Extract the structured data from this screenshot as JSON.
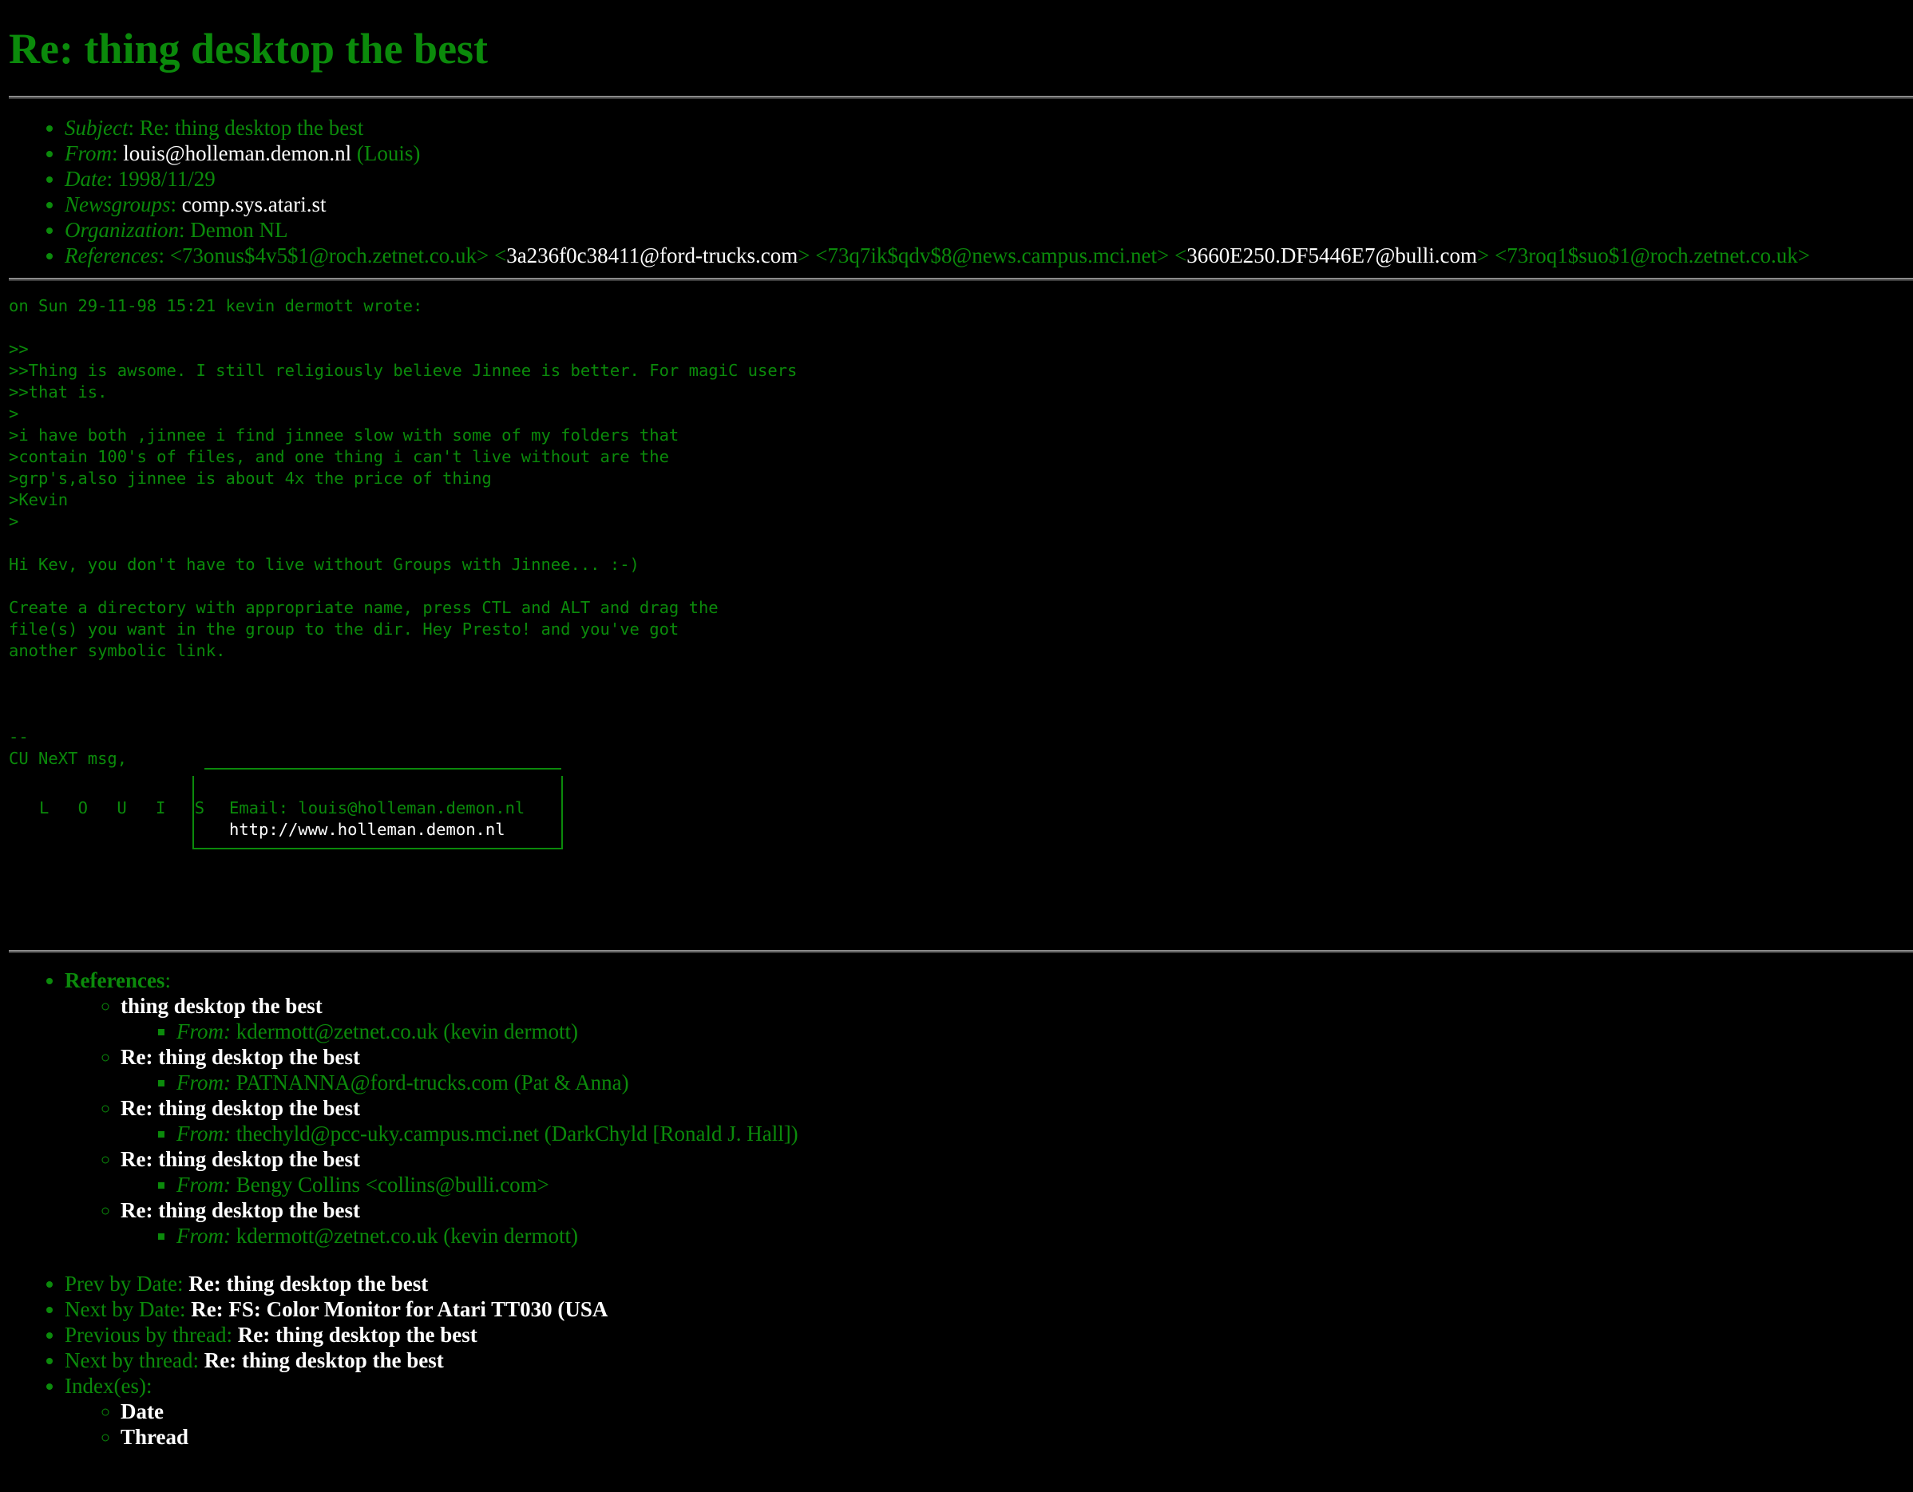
{
  "title": "Re: thing desktop the best",
  "meta": {
    "subject_label": "Subject",
    "subject": "Re: thing desktop the best",
    "from_label": "From",
    "from_email": "louis@holleman.demon.nl",
    "from_name": "(Louis)",
    "date_label": "Date",
    "date": "1998/11/29",
    "newsgroups_label": "Newsgroups",
    "newsgroups": "comp.sys.atari.st",
    "org_label": "Organization",
    "org": "Demon NL",
    "references_label": "References",
    "references": [
      "<73onus$4v5$1@roch.zetnet.co.uk>",
      "3a236f0c38411@ford-trucks.com",
      "<73q7ik$qdv$8@news.campus.mci.net>",
      "3660E250.DF5446E7@bulli.com",
      "<73roq1$suo$1@roch.zetnet.co.uk>"
    ]
  },
  "body_text": "on Sun 29-11-98 15:21 kevin dermott wrote:\n\n>>\n>>Thing is awsome. I still religiously believe Jinnee is better. For magiC users\n>>that is.\n>\n>i have both ,jinnee i find jinnee slow with some of my folders that\n>contain 100's of files, and one thing i can't live without are the\n>grp's,also jinnee is about 4x the price of thing\n>Kevin\n>\n\nHi Kev, you don't have to live without Groups with Jinnee... :-)\n\nCreate a directory with appropriate name, press CTL and ALT and drag the\nfile(s) you want in the group to the dir. Hey Presto! and you've got\nanother symbolic link.\n\n\n\n--\nCU NeXT msg,",
  "signature": {
    "name": "L O U I S",
    "email_line": "Email: louis@holleman.demon.nl",
    "url": "http://www.holleman.demon.nl"
  },
  "refs_section": {
    "heading": "References",
    "items": [
      {
        "title": "thing desktop the best",
        "from_label": "From:",
        "from": "kdermott@zetnet.co.uk (kevin dermott)"
      },
      {
        "title": "Re: thing desktop the best",
        "from_label": "From:",
        "from": "PATNANNA@ford-trucks.com (Pat & Anna)"
      },
      {
        "title": "Re: thing desktop the best",
        "from_label": "From:",
        "from": "thechyld@pcc-uky.campus.mci.net (DarkChyld [Ronald J. Hall])"
      },
      {
        "title": "Re: thing desktop the best",
        "from_label": "From:",
        "from": "Bengy Collins <collins@bulli.com>"
      },
      {
        "title": "Re: thing desktop the best",
        "from_label": "From:",
        "from": "kdermott@zetnet.co.uk (kevin dermott)"
      }
    ]
  },
  "nav": {
    "prev_date_label": "Prev by Date:",
    "prev_date": "Re: thing desktop the best",
    "next_date_label": "Next by Date:",
    "next_date": "Re: FS: Color Monitor for Atari TT030 (USA",
    "prev_thread_label": "Previous by thread:",
    "prev_thread": "Re: thing desktop the best",
    "next_thread_label": "Next by thread:",
    "next_thread": "Re: thing desktop the best",
    "index_label": "Index(es):",
    "index_date": "Date",
    "index_thread": "Thread"
  },
  "colors": {
    "background": "#000000",
    "text_green": "#0b8a0b",
    "link_white": "#ffffff"
  }
}
